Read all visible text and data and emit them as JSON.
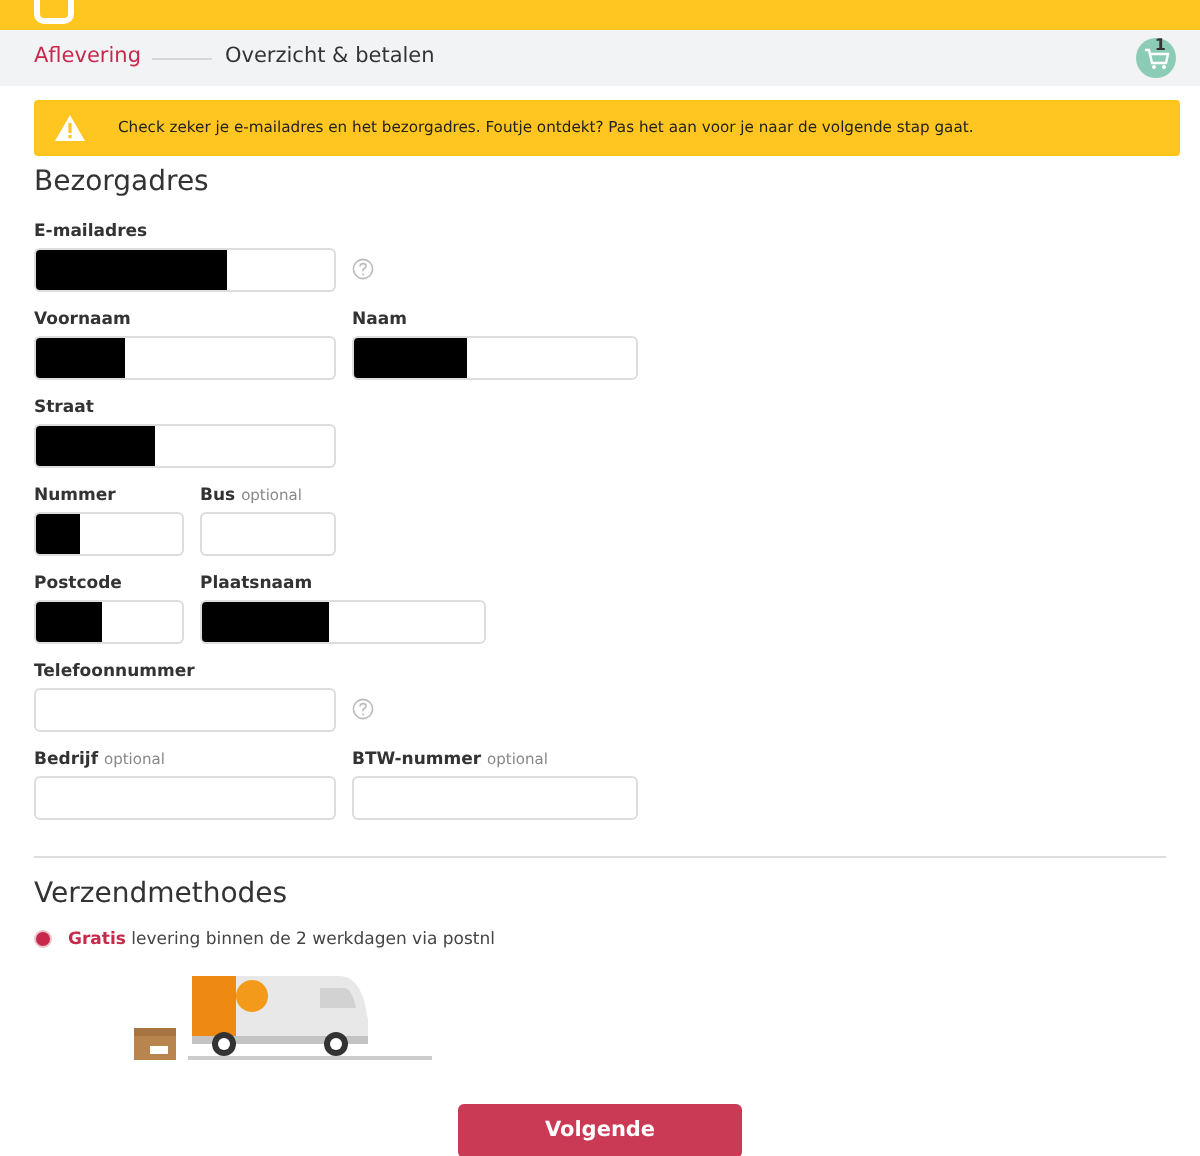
{
  "steps": [
    {
      "label": "Aflevering",
      "selected": true
    },
    {
      "label": "Overzicht & betalen",
      "selected": false
    }
  ],
  "cart": {
    "count": "1"
  },
  "alert": {
    "text": "Check zeker je e-mailadres en het bezorgadres. Foutje ontdekt? Pas het aan voor je naar de volgende stap gaat."
  },
  "address": {
    "title": "Bezorgadres",
    "rows": [
      {
        "kind": "wide",
        "fields": [
          {
            "label": "E-mailadres",
            "help": true,
            "redacted": true
          }
        ]
      },
      {
        "kind": "pair",
        "fields": [
          {
            "label": "Voornaam",
            "redacted": true
          },
          {
            "label": "Naam",
            "redacted": true
          }
        ]
      },
      {
        "kind": "wide",
        "fields": [
          {
            "label": "Straat",
            "redacted": true
          }
        ]
      },
      {
        "kind": "split",
        "fields": [
          {
            "label": "Nummer",
            "redacted": true
          },
          {
            "label": "Bus",
            "note": "optional",
            "redacted": false
          }
        ]
      },
      {
        "kind": "split-wide",
        "fields": [
          {
            "label": "Postcode",
            "redacted": true
          },
          {
            "label": "Plaatsnaam",
            "redacted": true
          }
        ]
      },
      {
        "kind": "wide",
        "fields": [
          {
            "label": "Telefoonnummer",
            "help": true,
            "redacted": false
          }
        ]
      },
      {
        "kind": "pair",
        "fields": [
          {
            "label": "Bedrijf",
            "note": "optional",
            "redacted": false
          },
          {
            "label": "BTW-nummer",
            "note": "optional",
            "redacted": false
          }
        ]
      }
    ]
  },
  "shipping": {
    "title": "Verzendmethodes",
    "options": [
      {
        "text": "**Gratis** levering binnen de 2 werkdagen via postnl",
        "selected": true
      }
    ]
  },
  "next_button": "Volgende"
}
